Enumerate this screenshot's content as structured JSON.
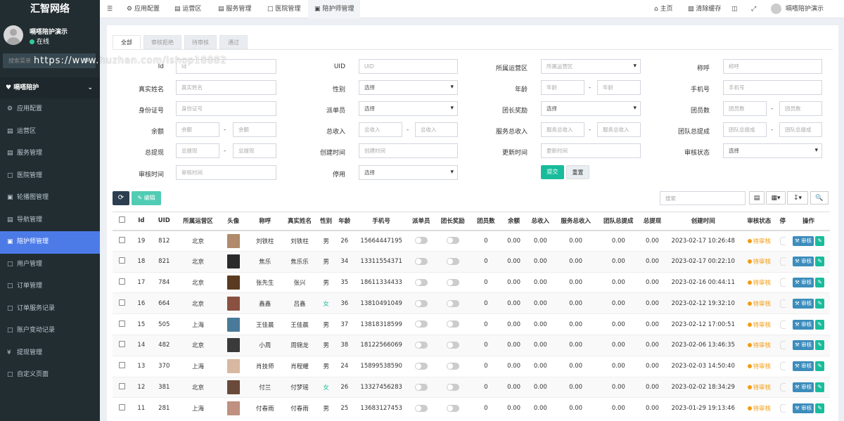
{
  "app": {
    "logo": "汇智网络"
  },
  "user": {
    "name": "嗝嗒陪护演示",
    "status": "在线"
  },
  "sidebar": {
    "search_placeholder": "搜索菜单",
    "header": "嗝嗒陪护",
    "items": [
      {
        "label": "应用配置",
        "icon": "gear-icon"
      },
      {
        "label": "运营区",
        "icon": "map-icon"
      },
      {
        "label": "服务管理",
        "icon": "list-icon"
      },
      {
        "label": "医院管理",
        "icon": "hospital-icon"
      },
      {
        "label": "轮播图管理",
        "icon": "image-icon"
      },
      {
        "label": "导航管理",
        "icon": "nav-icon"
      },
      {
        "label": "陪护师管理",
        "icon": "card-icon"
      },
      {
        "label": "用户管理",
        "icon": "user-icon"
      },
      {
        "label": "订单管理",
        "icon": "order-icon"
      },
      {
        "label": "订单服务记录",
        "icon": "record-icon"
      },
      {
        "label": "账户变动记录",
        "icon": "account-icon"
      },
      {
        "label": "提现管理",
        "icon": "yen-icon"
      },
      {
        "label": "自定义页面",
        "icon": "page-icon"
      }
    ]
  },
  "watermark": "https://www.huzhan.com/ishop18882",
  "topbar": {
    "tabs": [
      "应用配置",
      "运营区",
      "服务管理",
      "医院管理",
      "陪护师管理"
    ],
    "home": "主页",
    "clear_cache": "清除缓存",
    "user": "嗝嗒陪护演示"
  },
  "filter_tabs": [
    "全部",
    "审核拒绝",
    "待审核",
    "通过"
  ],
  "form": {
    "id": {
      "label": "Id",
      "placeholder": "Id"
    },
    "uid": {
      "label": "UID",
      "placeholder": "UID"
    },
    "region": {
      "label": "所属运营区",
      "placeholder": "所属运营区"
    },
    "nickname": {
      "label": "称呼",
      "placeholder": "称呼"
    },
    "realname": {
      "label": "真实姓名",
      "placeholder": "真实姓名"
    },
    "gender": {
      "label": "性别",
      "value": "选择"
    },
    "age": {
      "label": "年龄",
      "placeholder": "年龄"
    },
    "phone": {
      "label": "手机号",
      "placeholder": "手机号"
    },
    "idcard": {
      "label": "身份证号",
      "placeholder": "身份证号"
    },
    "dispatcher": {
      "label": "派单员",
      "value": "选择"
    },
    "leader_reward": {
      "label": "团长奖励",
      "value": "选择"
    },
    "members": {
      "label": "团员数",
      "placeholder": "团员数"
    },
    "balance": {
      "label": "余额",
      "placeholder": "余额"
    },
    "total_income": {
      "label": "总收入",
      "placeholder": "总收入"
    },
    "service_income": {
      "label": "服务总收入",
      "placeholder": "服务总收入"
    },
    "team_commission": {
      "label": "团队总提成",
      "placeholder": "团队总提成"
    },
    "total_withdraw": {
      "label": "总提现",
      "placeholder": "总提现"
    },
    "created": {
      "label": "创建时间",
      "placeholder": "创建时间"
    },
    "updated": {
      "label": "更新时间",
      "placeholder": "更新时间"
    },
    "audit_status": {
      "label": "审核状态",
      "value": "选择"
    },
    "audit_time": {
      "label": "审核时间",
      "placeholder": "审核时间"
    },
    "disabled": {
      "label": "停用",
      "value": "选择"
    },
    "submit": "提交",
    "reset": "重置",
    "dash": "-"
  },
  "toolbar": {
    "edit": "编辑",
    "search_placeholder": "搜索"
  },
  "table": {
    "headers": [
      "Id",
      "UID",
      "所属运营区",
      "头像",
      "称呼",
      "真实姓名",
      "性别",
      "年龄",
      "手机号",
      "派单员",
      "团长奖励",
      "团员数",
      "余额",
      "总收入",
      "服务总收入",
      "团队总提成",
      "总提现",
      "创建时间",
      "审核状态",
      "停",
      "操作"
    ],
    "audit_label": "审核",
    "rows": [
      {
        "id": "19",
        "uid": "812",
        "region": "北京",
        "avatar": "#b08a6a",
        "nickname": "刘铁柱",
        "realname": "刘铁柱",
        "gender": "男",
        "age": "26",
        "phone": "15664447195",
        "members": "0",
        "balance": "0.00",
        "income": "0.00",
        "service": "0.00",
        "team": "0.00",
        "withdraw": "0.00",
        "created": "2023-02-17 10:26:48",
        "status": "待审核"
      },
      {
        "id": "18",
        "uid": "821",
        "region": "北京",
        "avatar": "#2b2b2b",
        "nickname": "焦乐",
        "realname": "焦乐乐",
        "gender": "男",
        "age": "34",
        "phone": "13311554371",
        "members": "0",
        "balance": "0.00",
        "income": "0.00",
        "service": "0.00",
        "team": "0.00",
        "withdraw": "0.00",
        "created": "2023-02-17 00:22:10",
        "status": "待审核"
      },
      {
        "id": "17",
        "uid": "784",
        "region": "北京",
        "avatar": "#5a3a20",
        "nickname": "张先生",
        "realname": "张兴",
        "gender": "男",
        "age": "35",
        "phone": "18611334433",
        "members": "0",
        "balance": "0.00",
        "income": "0.00",
        "service": "0.00",
        "team": "0.00",
        "withdraw": "0.00",
        "created": "2023-02-16 00:44:11",
        "status": "待审核"
      },
      {
        "id": "16",
        "uid": "664",
        "region": "北京",
        "avatar": "#8a5040",
        "nickname": "鑫鑫",
        "realname": "吕鑫",
        "gender": "女",
        "age": "36",
        "phone": "13810491049",
        "members": "0",
        "balance": "0.00",
        "income": "0.00",
        "service": "0.00",
        "team": "0.00",
        "withdraw": "0.00",
        "created": "2023-02-12 19:32:10",
        "status": "待审核"
      },
      {
        "id": "15",
        "uid": "505",
        "region": "上海",
        "avatar": "#4a7a9a",
        "nickname": "王佳晨",
        "realname": "王佳晨",
        "gender": "男",
        "age": "37",
        "phone": "13818318599",
        "members": "0",
        "balance": "0.00",
        "income": "0.00",
        "service": "0.00",
        "team": "0.00",
        "withdraw": "0.00",
        "created": "2023-02-12 17:00:51",
        "status": "待审核"
      },
      {
        "id": "14",
        "uid": "482",
        "region": "北京",
        "avatar": "#3a3a3a",
        "nickname": "小周",
        "realname": "周锦龙",
        "gender": "男",
        "age": "38",
        "phone": "18122566069",
        "members": "0",
        "balance": "0.00",
        "income": "0.00",
        "service": "0.00",
        "team": "0.00",
        "withdraw": "0.00",
        "created": "2023-02-06 13:46:35",
        "status": "待审核"
      },
      {
        "id": "13",
        "uid": "370",
        "region": "上海",
        "avatar": "#d8b8a0",
        "nickname": "肖技师",
        "realname": "肖程耀",
        "gender": "男",
        "age": "24",
        "phone": "15899538590",
        "members": "0",
        "balance": "0.00",
        "income": "0.00",
        "service": "0.00",
        "team": "0.00",
        "withdraw": "0.00",
        "created": "2023-02-03 14:50:40",
        "status": "待审核"
      },
      {
        "id": "12",
        "uid": "381",
        "region": "北京",
        "avatar": "#6a4a3a",
        "nickname": "付兰",
        "realname": "付梦瑶",
        "gender": "女",
        "age": "26",
        "phone": "13327456283",
        "members": "0",
        "balance": "0.00",
        "income": "0.00",
        "service": "0.00",
        "team": "0.00",
        "withdraw": "0.00",
        "created": "2023-02-02 18:34:29",
        "status": "待审核"
      },
      {
        "id": "11",
        "uid": "281",
        "region": "上海",
        "avatar": "#c09080",
        "nickname": "付春雨",
        "realname": "付春雨",
        "gender": "男",
        "age": "25",
        "phone": "13683127453",
        "members": "0",
        "balance": "0.00",
        "income": "0.00",
        "service": "0.00",
        "team": "0.00",
        "withdraw": "0.00",
        "created": "2023-01-29 19:13:46",
        "status": "待审核"
      }
    ]
  },
  "colors": {
    "sidebar": "#222d32",
    "active": "#4c7be8",
    "primary": "#18bc9c",
    "pending": "#f39c12",
    "audit": "#3c8dbc"
  }
}
